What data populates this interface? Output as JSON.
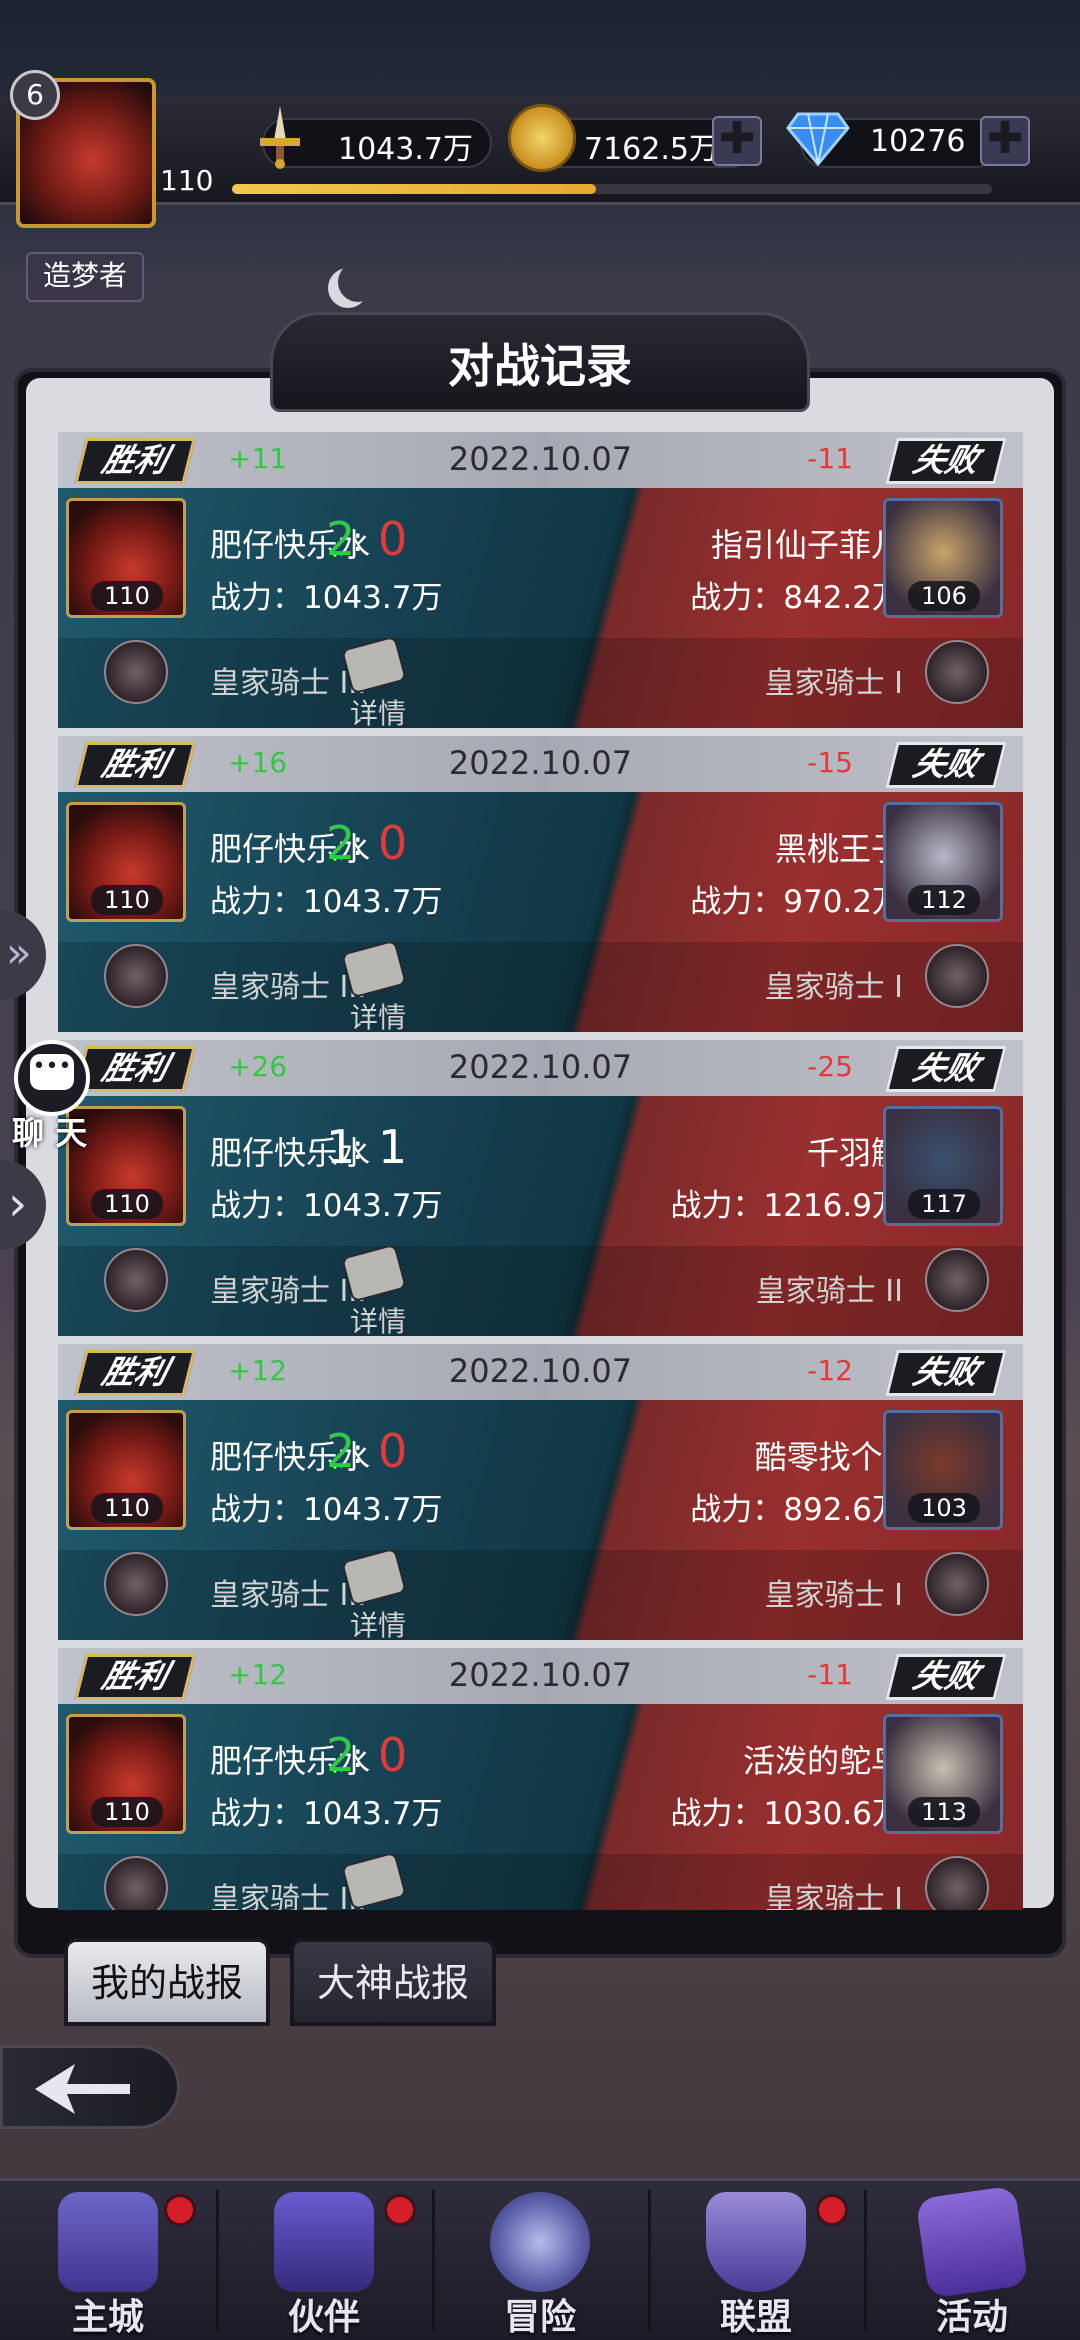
{
  "player": {
    "vip": "6",
    "level": "110",
    "title": "造梦者"
  },
  "resources": {
    "power": "1043.7万",
    "gold": "7162.5万",
    "diamonds": "10276"
  },
  "panel": {
    "title": "对战记录"
  },
  "records": [
    {
      "result_left": "胜利",
      "result_right": "失败",
      "delta_left": "+11",
      "delta_right": "-11",
      "date": "2022.10.07",
      "left": {
        "name": "肥仔快乐水",
        "power": "战力：1043.7万",
        "rank": "皇家骑士 III",
        "level": "110"
      },
      "score_left": "2",
      "colon": ":",
      "score_right": "0",
      "detail": "详情",
      "right": {
        "name": "指引仙子菲儿",
        "power": "战力：842.2万",
        "rank": "皇家骑士 I",
        "level": "106"
      }
    },
    {
      "result_left": "胜利",
      "result_right": "失败",
      "delta_left": "+16",
      "delta_right": "-15",
      "date": "2022.10.07",
      "left": {
        "name": "肥仔快乐水",
        "power": "战力：1043.7万",
        "rank": "皇家骑士 III",
        "level": "110"
      },
      "score_left": "2",
      "colon": ":",
      "score_right": "0",
      "detail": "详情",
      "right": {
        "name": "黑桃王子",
        "power": "战力：970.2万",
        "rank": "皇家骑士 I",
        "level": "112"
      }
    },
    {
      "result_left": "胜利",
      "result_right": "失败",
      "delta_left": "+26",
      "delta_right": "-25",
      "date": "2022.10.07",
      "left": {
        "name": "肥仔快乐水",
        "power": "战力：1043.7万",
        "rank": "皇家骑士 III",
        "level": "110"
      },
      "score_left": "1",
      "colon": ":",
      "score_right": "1",
      "detail": "详情",
      "right": {
        "name": "千羽觞",
        "power": "战力：1216.9万",
        "rank": "皇家骑士 II",
        "level": "117"
      }
    },
    {
      "result_left": "胜利",
      "result_right": "失败",
      "delta_left": "+12",
      "delta_right": "-12",
      "date": "2022.10.07",
      "left": {
        "name": "肥仔快乐水",
        "power": "战力：1043.7万",
        "rank": "皇家骑士 III",
        "level": "110"
      },
      "score_left": "2",
      "colon": ":",
      "score_right": "0",
      "detail": "详情",
      "right": {
        "name": "酷零找个1",
        "power": "战力：892.6万",
        "rank": "皇家骑士 I",
        "level": "103"
      }
    },
    {
      "result_left": "胜利",
      "result_right": "失败",
      "delta_left": "+12",
      "delta_right": "-11",
      "date": "2022.10.07",
      "left": {
        "name": "肥仔快乐水",
        "power": "战力：1043.7万",
        "rank": "皇家骑士 III",
        "level": "110"
      },
      "score_left": "2",
      "colon": ":",
      "score_right": "0",
      "detail": "详情",
      "right": {
        "name": "活泼的鸵鸟",
        "power": "战力：1030.6万",
        "rank": "皇家骑士 I",
        "level": "113"
      }
    }
  ],
  "tabs": {
    "mine": "我的战报",
    "experts": "大神战报"
  },
  "chat": {
    "label": "聊 天"
  },
  "nav": [
    {
      "label": "主城"
    },
    {
      "label": "伙伴"
    },
    {
      "label": "冒险"
    },
    {
      "label": "联盟"
    },
    {
      "label": "活动"
    }
  ],
  "colors": {
    "win_green": "#35c844",
    "lose_red": "#e23a3a",
    "notify_dot": "#d81d2a"
  }
}
